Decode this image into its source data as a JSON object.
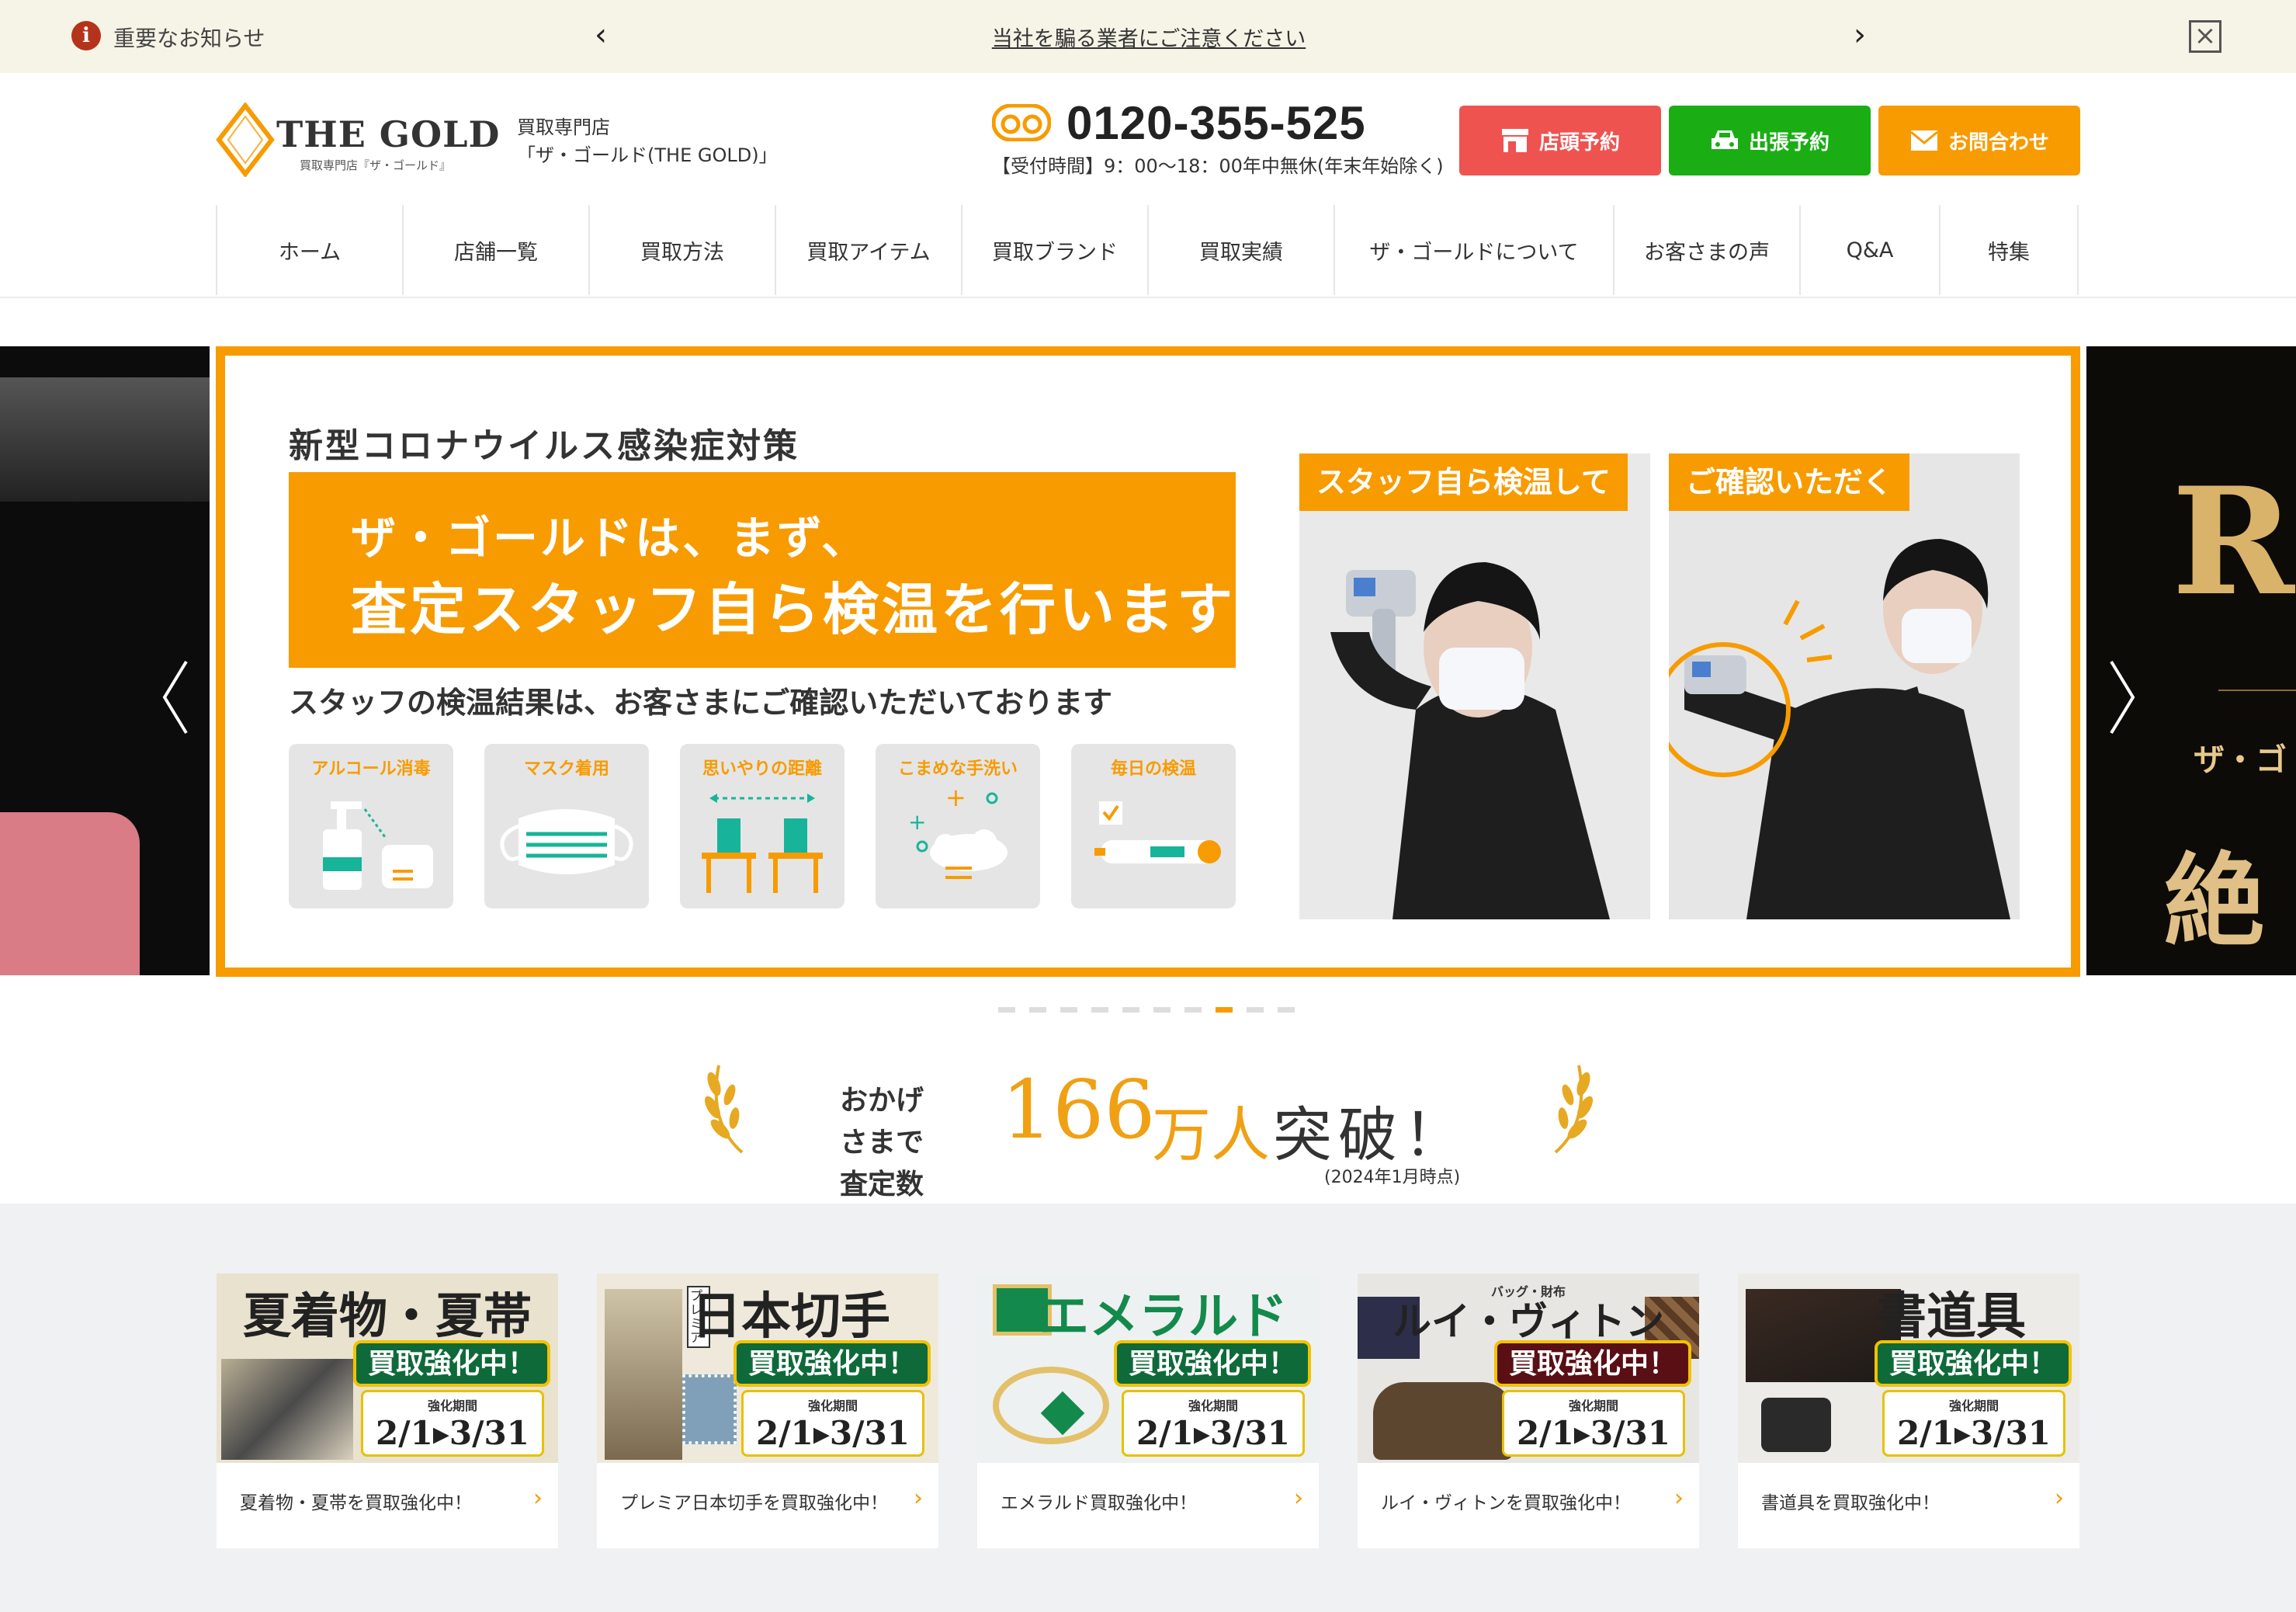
{
  "notice": {
    "label": "重要なお知らせ",
    "message": "当社を騙る業者にご注意ください",
    "prev": "‹",
    "next": "›",
    "close": "×"
  },
  "header": {
    "logo_text": "THE GOLD",
    "logo_sub": "買取専門店『ザ・ゴールド』",
    "store_line1": "買取専門店",
    "store_line2": "「ザ・ゴールド(THE GOLD)」",
    "phone": "0120-355-525",
    "hours": "【受付時間】9：00〜18：00年中無休(年末年始除く)",
    "buttons": [
      {
        "label": "店頭予約",
        "color": "#ef5350"
      },
      {
        "label": "出張予約",
        "color": "#1aae14"
      },
      {
        "label": "お問合わせ",
        "color": "#f79b00"
      }
    ]
  },
  "nav": [
    "ホーム",
    "店舗一覧",
    "買取方法",
    "買取アイテム",
    "買取ブランド",
    "買取実績",
    "ザ・ゴールドについて",
    "お客さまの声",
    "Q&A",
    "特集"
  ],
  "slide": {
    "title": "新型コロナウイルス感染症対策",
    "band_line1": "ザ・ゴールドは、まず、",
    "band_line2": "査定スタッフ自ら検温を行います",
    "subtitle": "スタッフの検温結果は、お客さまにご確認いただいております",
    "cards": [
      "アルコール消毒",
      "マスク着用",
      "思いやりの距離",
      "こまめな手洗い",
      "毎日の検温"
    ],
    "photo_captions": [
      "スタッフ自ら検温して",
      "ご確認いただく"
    ],
    "right_peek_big": "R",
    "right_peek_mid": "ザ・ゴ",
    "right_peek_bottom": "絶対",
    "dots_total": 10,
    "dots_active": 8
  },
  "achievement": {
    "pre": "おかげさまで 査定数",
    "number": "166",
    "unit": "万人",
    "suffix": "突破！",
    "date": "(2024年1月時点)"
  },
  "campaigns": [
    {
      "heading": "夏着物・夏帯",
      "badge": "買取強化中！",
      "period_label": "強化期間",
      "period": "2/1▸3/31",
      "caption": "夏着物・夏帯を買取強化中！",
      "bg": "#e9e2cf"
    },
    {
      "heading": "日本切手",
      "badge": "買取強化中！",
      "period_label": "強化期間",
      "period": "2/1▸3/31",
      "caption": "プレミア日本切手を買取強化中！",
      "bg": "#efe9dc",
      "tag": "プレミア"
    },
    {
      "heading": "エメラルド",
      "badge": "買取強化中！",
      "period_label": "強化期間",
      "period": "2/1▸3/31",
      "caption": "エメラルド買取強化中！",
      "bg": "#eef1f1"
    },
    {
      "heading": "ルイ・ヴィトン",
      "badge": "買取強化中！",
      "period_label": "強化期間",
      "period": "2/1▸3/31",
      "caption": "ルイ・ヴィトンを買取強化中！",
      "bg": "#e8e6e3",
      "tag": "バッグ・財布"
    },
    {
      "heading": "書道具",
      "badge": "買取強化中！",
      "period_label": "強化期間",
      "period": "2/1▸3/31",
      "caption": "書道具を買取強化中！",
      "bg": "#ecebe8"
    }
  ]
}
